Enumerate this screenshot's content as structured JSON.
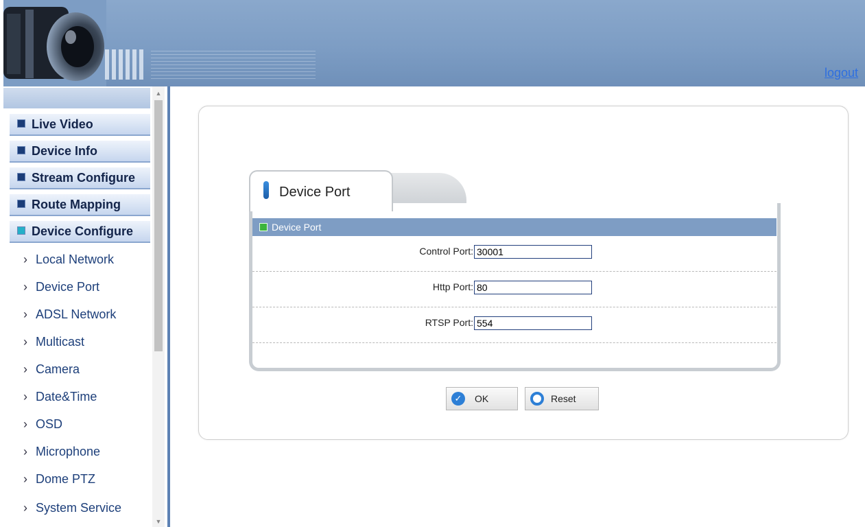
{
  "header": {
    "logout_label": "logout"
  },
  "sidebar": {
    "menu": [
      {
        "label": "Live Video"
      },
      {
        "label": "Device Info"
      },
      {
        "label": "Stream Configure"
      },
      {
        "label": "Route Mapping"
      },
      {
        "label": "Device Configure"
      }
    ],
    "sub_items": [
      {
        "label": "Local Network"
      },
      {
        "label": "Device Port"
      },
      {
        "label": "ADSL Network"
      },
      {
        "label": "Multicast"
      },
      {
        "label": "Camera"
      },
      {
        "label": "Date&Time"
      },
      {
        "label": "OSD"
      },
      {
        "label": "Microphone"
      },
      {
        "label": "Dome PTZ"
      },
      {
        "label": "System Service"
      }
    ],
    "active_menu": "Device Configure"
  },
  "main": {
    "tab_title": "Device Port",
    "section_title": "Device Port",
    "fields": {
      "control_port": {
        "label": "Control Port:",
        "value": "30001"
      },
      "http_port": {
        "label": "Http Port:",
        "value": "80"
      },
      "rtsp_port": {
        "label": "RTSP Port:",
        "value": "554"
      }
    },
    "buttons": {
      "ok": "OK",
      "reset": "Reset"
    }
  },
  "colors": {
    "header_blue": "#7d9dc4",
    "section_bar": "#7e9dc4",
    "link_blue": "#2e6fe0",
    "sidebar_border": "#5d82b4"
  }
}
